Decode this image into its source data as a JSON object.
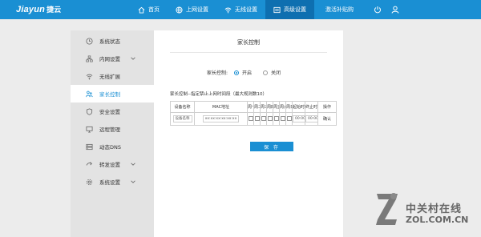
{
  "header": {
    "brand_en": "Jiayun",
    "brand_cn": "捷云",
    "nav": [
      {
        "label": "首页",
        "icon": "home-icon",
        "active": false
      },
      {
        "label": "上网设置",
        "icon": "globe-icon",
        "active": false
      },
      {
        "label": "无线设置",
        "icon": "wifi-icon",
        "active": false
      },
      {
        "label": "高级设置",
        "icon": "sliders-icon",
        "active": true
      },
      {
        "label": "激活补贴购",
        "icon": "",
        "active": false
      }
    ],
    "right_icons": [
      "power-icon",
      "user-icon"
    ]
  },
  "sidebar": {
    "items": [
      {
        "label": "系统状态",
        "icon": "clock-icon"
      },
      {
        "label": "内网设置",
        "icon": "network-icon",
        "expandable": true
      },
      {
        "label": "无线扩展",
        "icon": "wifi-icon"
      },
      {
        "label": "家长控制",
        "icon": "parent-icon",
        "active": true
      },
      {
        "label": "安全设置",
        "icon": "shield-icon"
      },
      {
        "label": "远程管理",
        "icon": "remote-icon"
      },
      {
        "label": "动态DNS",
        "icon": "dns-icon"
      },
      {
        "label": "转发设置",
        "icon": "forward-icon",
        "expandable": true
      },
      {
        "label": "系统设置",
        "icon": "gear-icon",
        "expandable": true
      }
    ]
  },
  "main": {
    "title": "家长控制",
    "control_label": "家长控制:",
    "options": {
      "on": "开启",
      "off": "关闭",
      "selected": "on"
    },
    "section_label": "家长控制--指定禁止上网时间段（最大规则数10）",
    "table": {
      "headers": [
        "设备名称",
        "MAC地址",
        "周一",
        "周二",
        "周三",
        "周四",
        "周五",
        "周六",
        "周日",
        "起始时间",
        "终止时间",
        "操作"
      ],
      "row": {
        "device_placeholder": "设备名称",
        "mac_placeholder": "xx:xx:xx:xx:xx:xx",
        "start_time": "00:00",
        "end_time": "00:00",
        "action": "确认"
      }
    },
    "save_label": "保 存"
  },
  "watermark": {
    "text_cn": "中关村在线",
    "text_en": "ZOL.COM.CN"
  },
  "colors": {
    "accent": "#1a8fd3",
    "nav_active": "#0e6fb0",
    "sidebar_bg": "#e3e3e3",
    "page_bg": "#ececec"
  }
}
